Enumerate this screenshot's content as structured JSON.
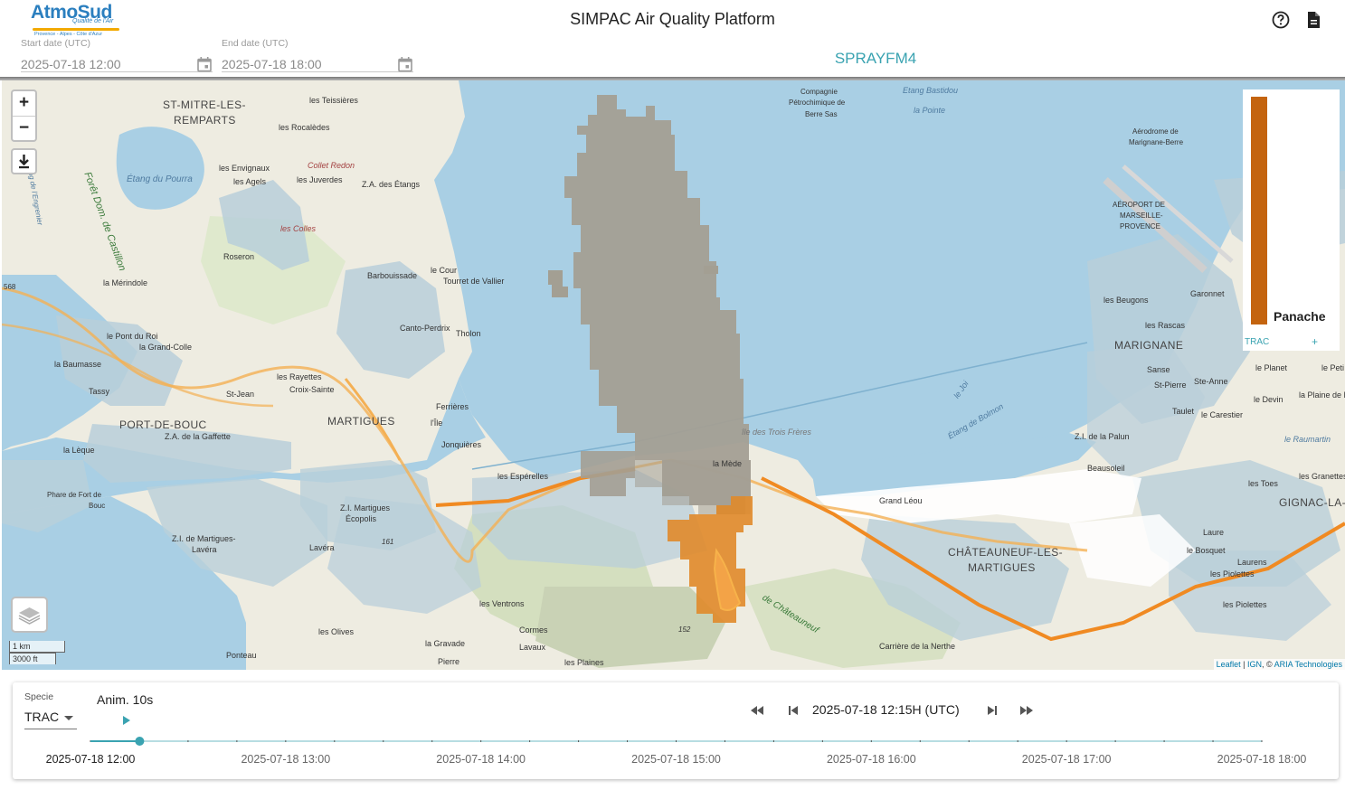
{
  "header": {
    "logo_name": "AtmoSud",
    "logo_tagline": "Qualité de l'Air",
    "logo_region": "Provence - Alpes - Côte d'Azur",
    "title": "SIMPAC Air Quality Platform",
    "model": "SPRAYFM4",
    "start_date": {
      "label": "Start date (UTC)",
      "value": "2025-07-18 12:00"
    },
    "end_date": {
      "label": "End date (UTC)",
      "value": "2025-07-18 18:00"
    },
    "icons": [
      "help-circle-icon",
      "document-icon",
      "calendar-icon"
    ]
  },
  "map": {
    "zoom_in": "+",
    "zoom_out": "−",
    "scale": {
      "metric": "1 km",
      "imperial": "3000 ft"
    },
    "attribution": {
      "leaflet": "Leaflet",
      "sep1": " | ",
      "ign": "IGN",
      "sep2": ", © ",
      "aria": "ARIA Technologies"
    },
    "places": {
      "saint_mitre": "ST-MITRE-LES-",
      "remparts": "REMPARTS",
      "teissieres": "les Teissières",
      "rocaledes": "les Rocalèdes",
      "compagnie1": "Compagnie",
      "compagnie2": "Pétrochimique de",
      "compagnie3": "Berre Sas",
      "etang_bastidou": "Etang Bastidou",
      "la_pointe": "la Pointe",
      "aerodrome1": "Aérodrome de",
      "aerodrome2": "Marignane-Berre",
      "aeroport1": "AÉROPORT DE",
      "aeroport2": "MARSEILLE-",
      "aeroport3": "PROVENCE",
      "etang_poura": "Étang du Pourra",
      "collet_redon": "Collet Redon",
      "envignaux": "les Envignaux",
      "agels": "les Agels",
      "juverdes": "les Juverdes",
      "za_etangs": "Z.A. des Étangs",
      "les_colles": "les Colles",
      "roseron": "Roseron",
      "barbouissade": "Barbouissade",
      "cour": "le Cour",
      "tourret": "Tourret de Vallier",
      "merindole": "la Mérindole",
      "canto_perdrix": "Canto-Perdrix",
      "tholon": "Tholon",
      "pont_du_roi": "le Pont du Roi",
      "grand_colle": "la Grand-Colle",
      "baumasse": "la Baumasse",
      "tassy": "Tassy",
      "rayettes": "les Rayettes",
      "croix_sainte": "Croix-Sainte",
      "st_jean": "St-Jean",
      "port_de_bouc": "PORT-DE-BOUC",
      "martigues": "MARTIGUES",
      "ferrieres": "Ferrières",
      "lile": "l'Île",
      "za_gaffette": "Z.A. de la Gaffette",
      "jonquieres": "Jonquières",
      "leque": "la Lèque",
      "esperelles": "les Espérelles",
      "phare1": "Phare de Fort de",
      "phare2": "Bouc",
      "zi_martigues1": "Z.I. Martigues",
      "zi_martigues2": "Écopolis",
      "zi_lavera1": "Z.I. de Martigues-",
      "zi_lavera2": "Lavéra",
      "lavera": "Lavéra",
      "ventrons": "les Ventrons",
      "olives": "les Olives",
      "gravade": "la Gravade",
      "cormes": "Cormes",
      "lavaux": "Lavaux",
      "pierre": "Pierre",
      "plaines": "les Plaines",
      "ponteau": "Ponteau",
      "trois_freres": "île des Trois Frères",
      "la_mede": "la Mède",
      "grand_leou": "Grand Léou",
      "chateauneuf1": "CHÂTEAUNEUF-LES-",
      "chateauneuf2": "MARTIGUES",
      "carriere": "Carrière de la Nerthe",
      "route": "de Châteauneuf",
      "marignane": "MARIGNANE",
      "beugons": "les Beugons",
      "garonnet": "Garonnet",
      "rascas": "les Rascas",
      "planet": "le Planet",
      "sanse": "Sanse",
      "st_pierre": "St-Pierre",
      "ste_anne": "Ste-Anne",
      "devin": "le Devin",
      "taulet": "Taulet",
      "carestier": "le Carestier",
      "zi_palun": "Z.I. de la Palun",
      "beausoleil": "Beausoleil",
      "toes": "les Toes",
      "gignac": "GIGNAC-LA-",
      "laure": "Laure",
      "bosquet": "le Bosquet",
      "laurens": "Laurens",
      "piolettes1": "les Piolettes",
      "piolettes2": "les Piolettes",
      "grenettes": "les Granettes",
      "le_joi": "le Joi",
      "etang_bolmon": "Étang de Bolmon",
      "foret1": "Forêt Dom. de Castillon",
      "etang_engrenier": "Étang de l'Engrenier",
      "le_pet": "le Peti",
      "plaine": "la Plaine de N",
      "raumartin": "le Raumartin",
      "r152": "152",
      "r161": "161",
      "r568": "568"
    }
  },
  "legend": {
    "label": "Panache",
    "specie": "TRAC",
    "plus": "+",
    "color": "#c4640f"
  },
  "panel": {
    "specie_label": "Specie",
    "specie_value": "TRAC",
    "anim_label": "Anim. 10s",
    "current_time": "2025-07-18 12:15H (UTC)",
    "progress": 0.042,
    "tick_labels": [
      "2025-07-18 12:00",
      "2025-07-18 13:00",
      "2025-07-18 14:00",
      "2025-07-18 15:00",
      "2025-07-18 16:00",
      "2025-07-18 17:00",
      "2025-07-18 18:00"
    ],
    "accent": "#3aa3b1"
  }
}
